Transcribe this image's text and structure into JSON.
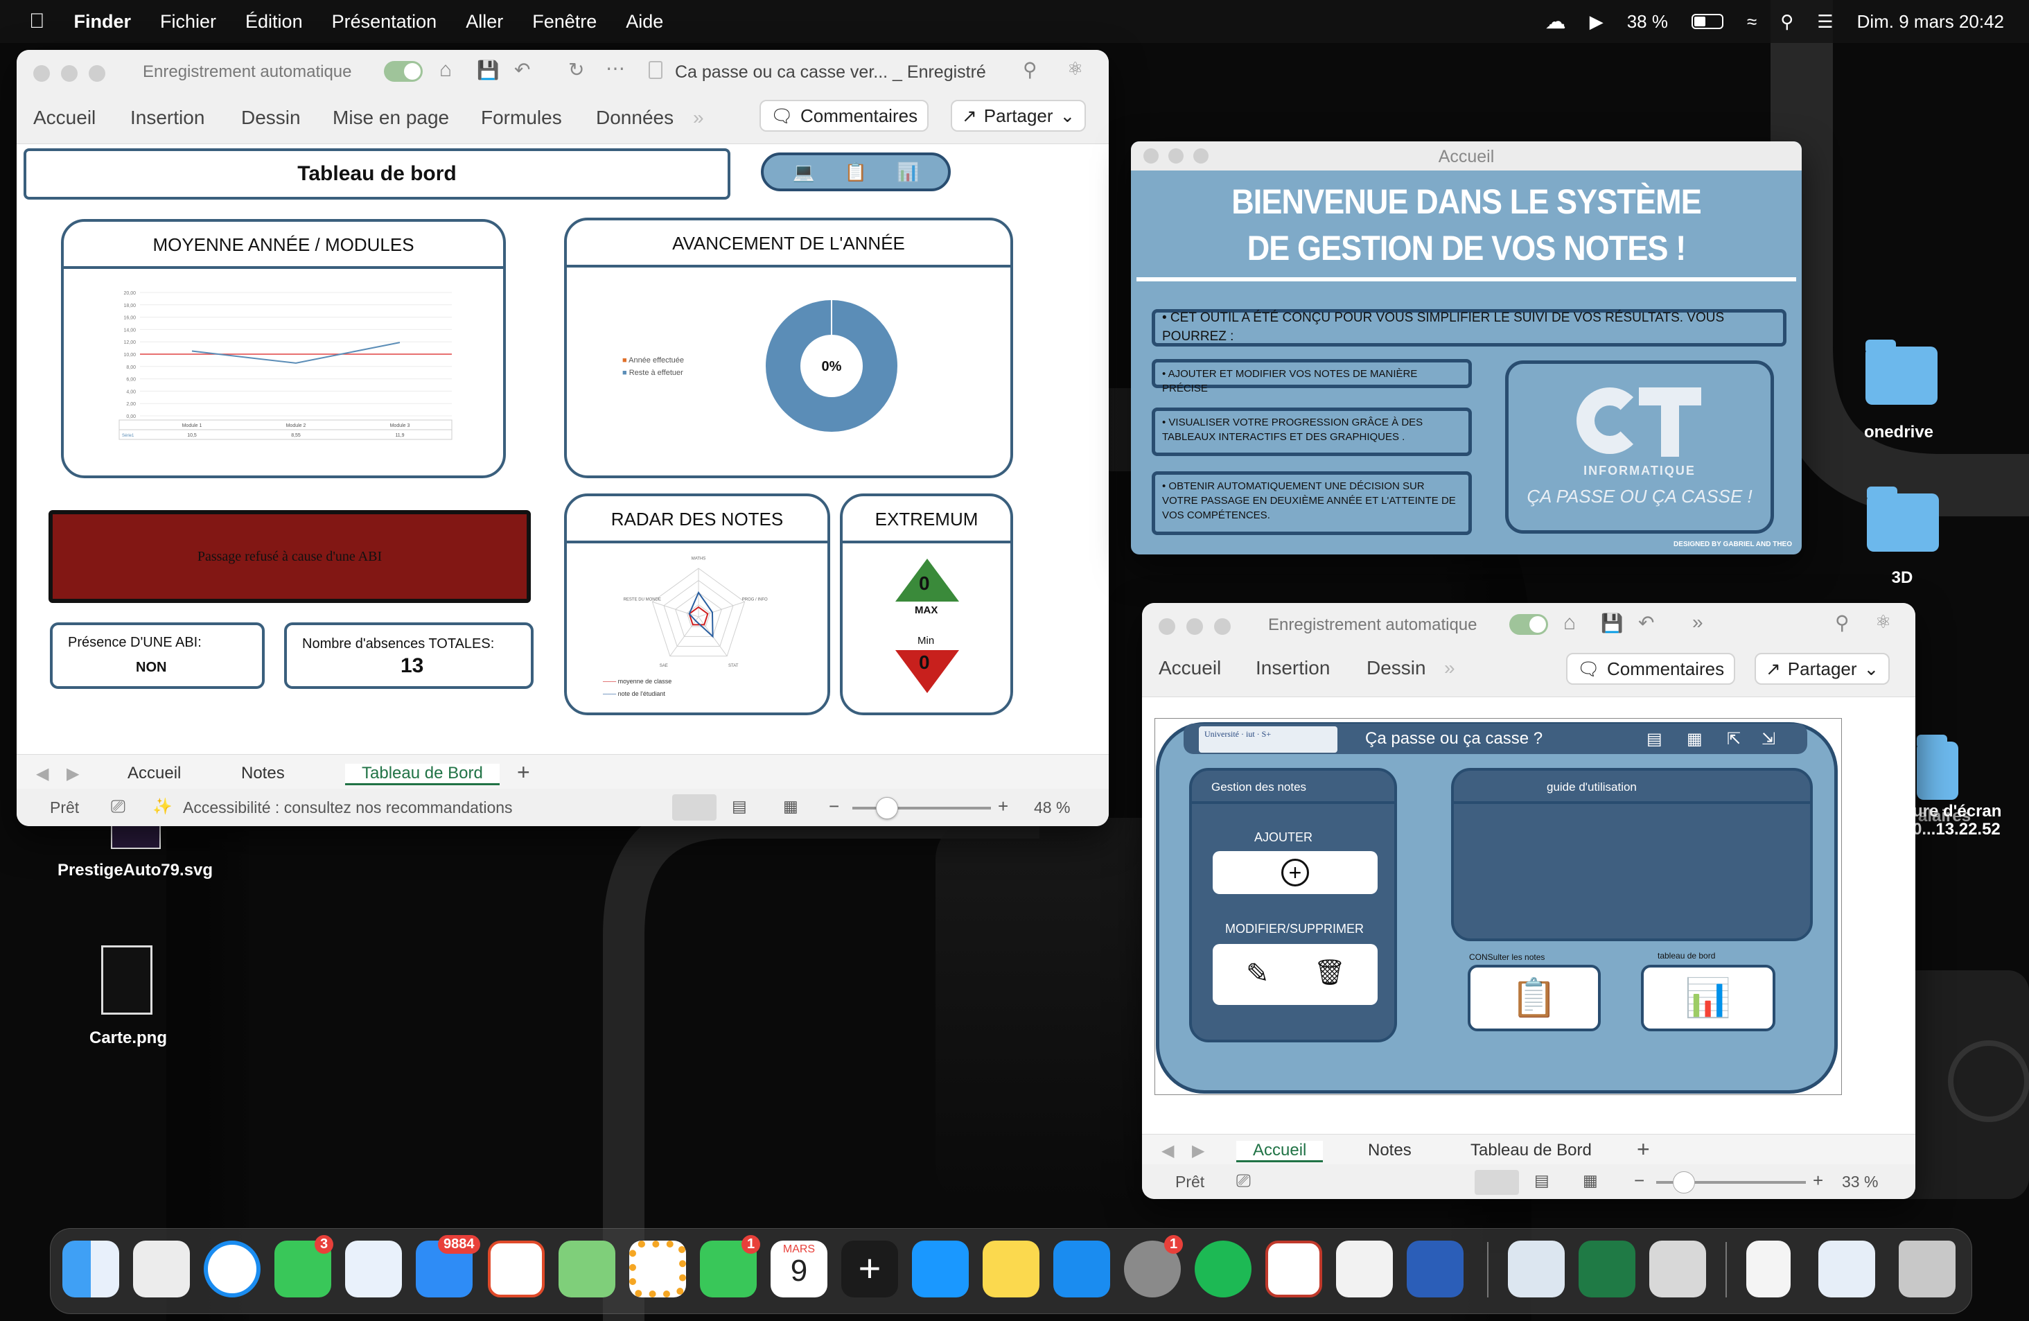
{
  "menubar": {
    "app": "Finder",
    "items": [
      "Fichier",
      "Édition",
      "Présentation",
      "Aller",
      "Fenêtre",
      "Aide"
    ],
    "battery": "38 %",
    "datetime": "Dim. 9 mars  20:42"
  },
  "excel1": {
    "autosave": "Enregistrement automatique",
    "doc_title": "Ca passe ou ca casse ver... _ Enregistré",
    "ribbon_tabs": [
      "Accueil",
      "Insertion",
      "Dessin",
      "Mise en page",
      "Formules",
      "Données"
    ],
    "comments": "Commentaires",
    "share": "Partager",
    "dashboard_title": "Tableau de bord",
    "panel_moyenne": "MOYENNE ANNÉE / MODULES",
    "panel_avancement": "AVANCEMENT DE L'ANNÉE",
    "panel_radar": "RADAR DES NOTES",
    "panel_extremum": "EXTREMUM",
    "status_message": "Passage refusé à cause d'une ABI",
    "abi_label": "Présence D'UNE ABI:",
    "abi_value": "NON",
    "absences_label": "Nombre d'absences TOTALES:",
    "absences_value": "13",
    "max_value": "0",
    "max_label": "MAX",
    "min_label": "Min",
    "min_value": "0",
    "sheets": [
      "Accueil",
      "Notes",
      "Tableau de Bord"
    ],
    "active_sheet": "Tableau de Bord",
    "status_ready": "Prêt",
    "accessibility": "Accessibilité : consultez nos recommandations",
    "zoom": "48 %"
  },
  "chart_data": [
    {
      "type": "line",
      "title": "",
      "categories": [
        "Module 1",
        "Module 2",
        "Module 3"
      ],
      "series": [
        {
          "name": "Série1",
          "values": [
            10.5,
            8.55,
            11.9
          ]
        }
      ],
      "reference_line": 10,
      "ylim": [
        0,
        20
      ],
      "yticks": [
        "0,00",
        "2,00",
        "4,00",
        "6,00",
        "8,00",
        "10,00",
        "12,00",
        "14,00",
        "16,00",
        "18,00",
        "20,00"
      ],
      "table_values": [
        "10,5",
        "8,55",
        "11,9"
      ]
    },
    {
      "type": "pie",
      "legend": [
        "Année effectuée",
        "Reste à effetuer"
      ],
      "values": [
        0,
        100
      ],
      "center_label": "0%",
      "colors": [
        "#e0702a",
        "#5b8db7"
      ]
    },
    {
      "type": "radar",
      "axes": [
        "MATHS",
        "PROG / INFO",
        "STAT",
        "SAE",
        "RESTE DU MONDE"
      ],
      "series": [
        {
          "name": "moyenne de classe",
          "values": [
            0.2,
            0.2,
            0.2,
            0.2,
            0.2
          ]
        },
        {
          "name": "note de l'étudiant",
          "values": [
            0.5,
            0.3,
            0.5,
            0.1,
            0.2
          ]
        }
      ]
    }
  ],
  "accueil": {
    "title": "Accueil",
    "heading": "BIENVENUE DANS LE SYSTÈME DE GESTION DE VOS NOTES !",
    "intro": "• CET OUTIL A ÉTÉ CONÇU POUR VOUS SIMPLIFIER LE SUIVI DE VOS RÉSULTATS. VOUS POURREZ :",
    "b1": "• AJOUTER ET MODIFIER VOS NOTES DE MANIÈRE PRÉCISE",
    "b2": "• VISUALISER VOTRE PROGRESSION GRÂCE À DES TABLEAUX INTERACTIFS ET DES GRAPHIQUES .",
    "b3": "• OBTENIR AUTOMATIQUEMENT UNE DÉCISION SUR VOTRE PASSAGE EN DEUXIÈME ANNÉE ET L'ATTEINTE DE VOS COMPÉTENCES.",
    "logo_sub": "INFORMATIQUE",
    "logo_slogan": "ÇA PASSE OU ÇA CASSE !",
    "credit": "DESIGNED BY GABRIEL AND THEO"
  },
  "excel2": {
    "autosave": "Enregistrement automatique",
    "ribbon_tabs": [
      "Accueil",
      "Insertion",
      "Dessin"
    ],
    "comments": "Commentaires",
    "share": "Partager",
    "app_title": "Ça passe ou ça casse ?",
    "gestion": "Gestion des notes",
    "ajouter": "AJOUTER",
    "modifier": "MODIFIER/SUPPRIMER",
    "guide": "guide d'utilisation",
    "consulter": "CONSulter les notes",
    "tableau": "tableau de bord",
    "sheets": [
      "Accueil",
      "Notes",
      "Tableau de Bord"
    ],
    "active_sheet": "Accueil",
    "status_ready": "Prêt",
    "zoom": "33 %"
  },
  "desktop": {
    "items": [
      "onedrive",
      "3D",
      "PrestigeAuto79.svg",
      "Carte.png"
    ],
    "screenshot_label": "ure d'écran\n0...13.22.52",
    "overlap": "alaires"
  },
  "dock": {
    "badges": {
      "messages": "3",
      "mail": "9884",
      "facetime": "1",
      "settings": "1"
    },
    "calendar_month": "MARS",
    "calendar_day": "9"
  }
}
